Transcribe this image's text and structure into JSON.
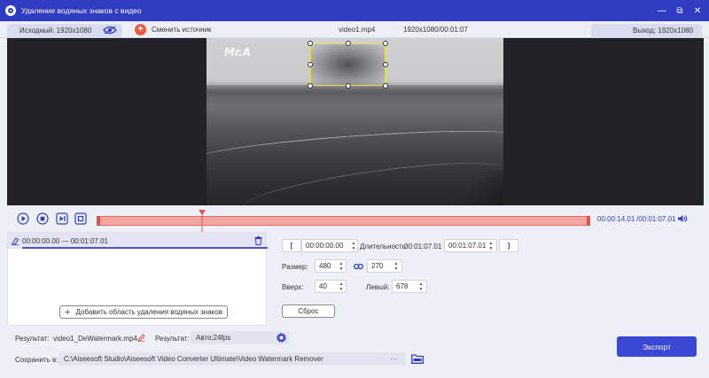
{
  "window": {
    "title": "Удаление водяных знаков с видео"
  },
  "infobar": {
    "source_label": "Исходный: 1920x1080",
    "change_source": "Сменить источник",
    "filename": "video1.mp4",
    "fileinfo": "1920x1080/00:01:07",
    "output_label": "Выход: 1920x1080"
  },
  "preview": {
    "watermark_text": "Mr.A"
  },
  "player": {
    "current_time": "00:00:14.01",
    "total_time": "/00:01:07.01"
  },
  "areas": {
    "item_range": "00:00:00.00 — 00:01:07.01",
    "add_button": "Добавить область удаления водяных знаков"
  },
  "params": {
    "start_time": "00:00:00.00",
    "duration_label": "Длительность:",
    "duration_value": "00:01:07.01",
    "end_time": "00:01:07.01",
    "size_label": "Размер:",
    "width": "480",
    "height": "270",
    "top_label": "Вверх:",
    "top": "40",
    "left_label": "Левый:",
    "left": "678",
    "reset": "Сброс"
  },
  "output": {
    "result_label": "Результат:",
    "result_file": "video1_DeWatermark.mp4",
    "result2_label": "Результат:",
    "format": "Авто;24fps",
    "save_label": "Сохранить в:",
    "save_path": "C:\\Aiseesoft Studio\\Aiseesoft Video Converter Ultimate\\Video Watermark Remover",
    "browse": "···",
    "export": "Экспорт"
  },
  "colors": {
    "accent": "#2f3cc2",
    "timeline": "#f2a7a0",
    "export": "#3a48d4"
  }
}
